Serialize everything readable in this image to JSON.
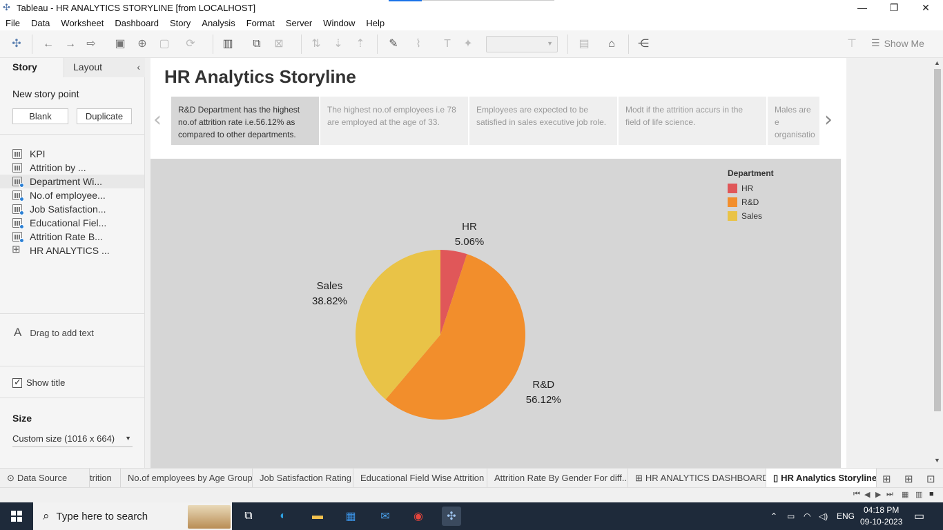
{
  "window": {
    "title": "Tableau - HR ANALYTICS STORYLINE [from LOCALHOST]"
  },
  "menu": [
    "File",
    "Data",
    "Worksheet",
    "Dashboard",
    "Story",
    "Analysis",
    "Format",
    "Server",
    "Window",
    "Help"
  ],
  "toolbar": {
    "show_me_label": "Show Me"
  },
  "left_pane": {
    "tab_story": "Story",
    "tab_layout": "Layout",
    "new_story_point": "New story point",
    "blank_button": "Blank",
    "duplicate_button": "Duplicate",
    "sheets": [
      {
        "label": "KPI",
        "icon": "bars",
        "badge": false
      },
      {
        "label": "Attrition by ...",
        "icon": "bars",
        "badge": false
      },
      {
        "label": "Department Wi...",
        "icon": "bars",
        "badge": true
      },
      {
        "label": "No.of employee...",
        "icon": "bars",
        "badge": true
      },
      {
        "label": "Job Satisfaction...",
        "icon": "bars",
        "badge": true
      },
      {
        "label": "Educational Fiel...",
        "icon": "bars",
        "badge": true
      },
      {
        "label": "Attrition Rate B...",
        "icon": "bars",
        "badge": true
      },
      {
        "label": "HR ANALYTICS ...",
        "icon": "grid",
        "badge": false
      }
    ],
    "drag_text": "Drag to add text",
    "show_title_label": "Show title",
    "size_heading": "Size",
    "size_value": "Custom size (1016 x 664)"
  },
  "story": {
    "title": "HR Analytics Storyline",
    "points": [
      {
        "text": "R&D Department has the highest no.of attrition rate i.e.56.12% as compared to other departments.",
        "active": true
      },
      {
        "text": "The highest no.of employees i.e 78 are employed at the age of 33.",
        "active": false
      },
      {
        "text": "Employees are expected to be satisfied in sales executive job role.",
        "active": false
      },
      {
        "text": "Modt if the attrition accurs in the field of life science.",
        "active": false
      },
      {
        "text": "Males are e organisatio",
        "active": false
      }
    ]
  },
  "chart_data": {
    "type": "pie",
    "legend_title": "Department",
    "legend_position": "top-right",
    "slices": [
      {
        "name": "HR",
        "value": 5.06,
        "label": "5.06%",
        "color": "#e05759"
      },
      {
        "name": "R&D",
        "value": 56.12,
        "label": "56.12%",
        "color": "#f28e2c"
      },
      {
        "name": "Sales",
        "value": 38.82,
        "label": "38.82%",
        "color": "#e9c347"
      }
    ]
  },
  "sheet_tabs": {
    "data_source": "Data Source",
    "tabs": [
      {
        "label": "trition",
        "active": false
      },
      {
        "label": "No.of employees by Age Group",
        "active": false
      },
      {
        "label": "Job Satisfaction Rating",
        "active": false
      },
      {
        "label": "Educational Field Wise Attrition",
        "active": false
      },
      {
        "label": "Attrition Rate By Gender For diff...",
        "active": false
      },
      {
        "label": "HR ANALYTICS DASHBOARD",
        "active": false
      },
      {
        "label": "HR Analytics Storyline",
        "active": true
      }
    ]
  },
  "taskbar": {
    "search_placeholder": "Type here to search",
    "language": "ENG",
    "time": "04:18 PM",
    "date": "09-10-2023"
  }
}
